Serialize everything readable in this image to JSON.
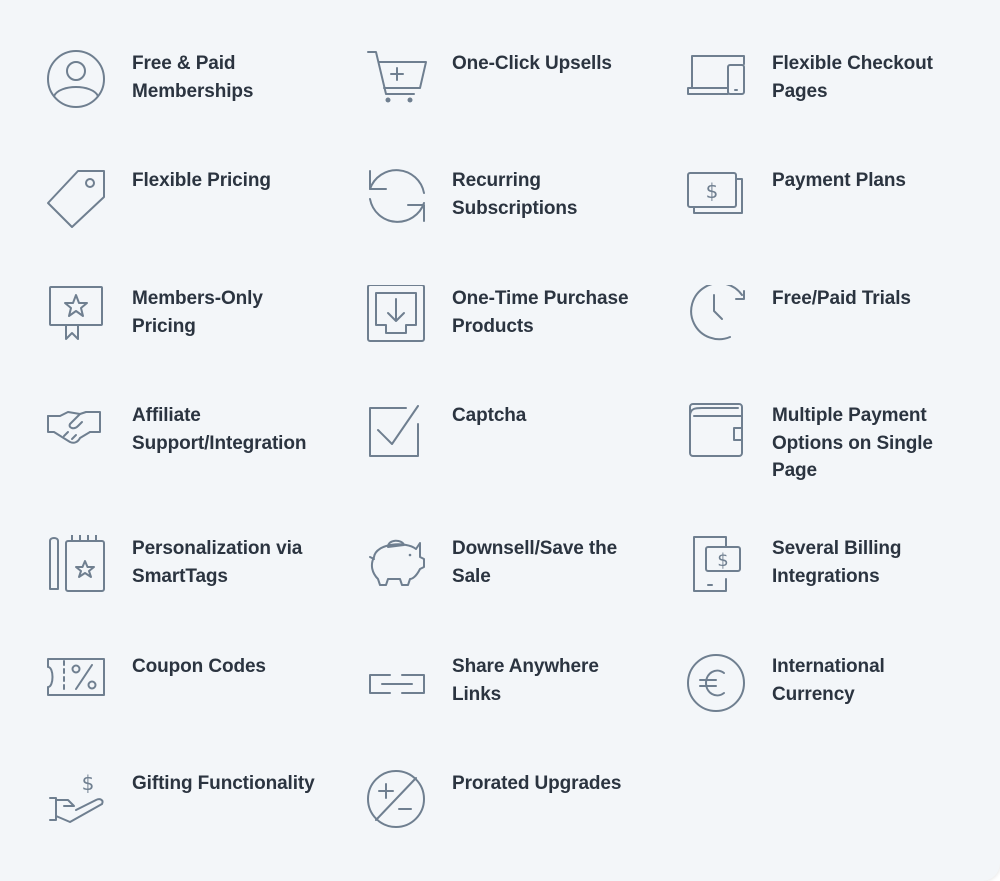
{
  "colors": {
    "background": "#f3f6f9",
    "text": "#2b3440",
    "icon": "#6f7f90"
  },
  "features": [
    {
      "icon": "user-circle-icon",
      "label_lines": [
        "Free & Paid",
        "Memberships"
      ]
    },
    {
      "icon": "cart-plus-icon",
      "label_lines": [
        "One-Click Upsells"
      ]
    },
    {
      "icon": "laptop-mobile-icon",
      "label_lines": [
        "Flexible Checkout",
        "Pages"
      ]
    },
    {
      "icon": "price-tag-icon",
      "label_lines": [
        "Flexible Pricing"
      ]
    },
    {
      "icon": "refresh-arrows-icon",
      "label_lines": [
        "Recurring",
        "Subscriptions"
      ]
    },
    {
      "icon": "banknote-dollar-icon",
      "label_lines": [
        "Payment Plans"
      ]
    },
    {
      "icon": "certificate-star-icon",
      "label_lines": [
        "Members-Only",
        "Pricing"
      ]
    },
    {
      "icon": "download-tray-icon",
      "label_lines": [
        "One-Time Purchase",
        "Products"
      ]
    },
    {
      "icon": "clock-rotate-icon",
      "label_lines": [
        "Free/Paid Trials"
      ]
    },
    {
      "icon": "handshake-icon",
      "label_lines": [
        "Affiliate",
        "Support/Integration"
      ]
    },
    {
      "icon": "checkbox-check-icon",
      "label_lines": [
        "Captcha"
      ]
    },
    {
      "icon": "wallet-icon",
      "label_lines": [
        "Multiple Payment",
        "Options on Single",
        "Page"
      ]
    },
    {
      "icon": "notebook-star-pen-icon",
      "label_lines": [
        "Personalization via",
        "SmartTags"
      ]
    },
    {
      "icon": "piggy-bank-icon",
      "label_lines": [
        "Downsell/Save the",
        "Sale"
      ]
    },
    {
      "icon": "phone-dollar-icon",
      "label_lines": [
        "Several Billing",
        "Integrations"
      ]
    },
    {
      "icon": "coupon-percent-icon",
      "label_lines": [
        "Coupon Codes"
      ]
    },
    {
      "icon": "link-icon",
      "label_lines": [
        "Share Anywhere",
        "Links"
      ]
    },
    {
      "icon": "euro-circle-icon",
      "label_lines": [
        "International",
        "Currency"
      ]
    },
    {
      "icon": "hand-dollar-icon",
      "label_lines": [
        "Gifting Functionality"
      ]
    },
    {
      "icon": "plus-minus-circle-icon",
      "label_lines": [
        "Prorated Upgrades"
      ]
    }
  ]
}
